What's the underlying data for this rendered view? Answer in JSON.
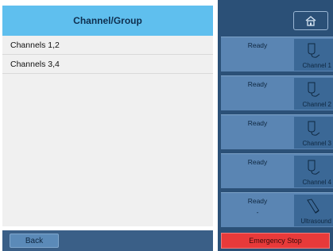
{
  "left_panel": {
    "title": "Channel/Group",
    "rows": [
      "Channels 1,2",
      "Channels 3,4"
    ],
    "back_label": "Back"
  },
  "right_panel": {
    "home_icon": "home-icon",
    "channels": [
      {
        "status": "Ready",
        "sub": "",
        "label": "Channel 1",
        "icon": "probe-icon"
      },
      {
        "status": "Ready",
        "sub": "",
        "label": "Channel 2",
        "icon": "probe-icon"
      },
      {
        "status": "Ready",
        "sub": "",
        "label": "Channel 3",
        "icon": "probe-icon"
      },
      {
        "status": "Ready",
        "sub": "",
        "label": "Channel 4",
        "icon": "probe-icon"
      },
      {
        "status": "Ready",
        "sub": "-",
        "label": "Ultrasound",
        "icon": "ultrasound-probe-icon"
      }
    ],
    "emergency_label": "Emergency Stop"
  },
  "colors": {
    "header_bg": "#5fbfee",
    "panel_bg": "#2b5077",
    "emergency": "#e83a3a"
  }
}
